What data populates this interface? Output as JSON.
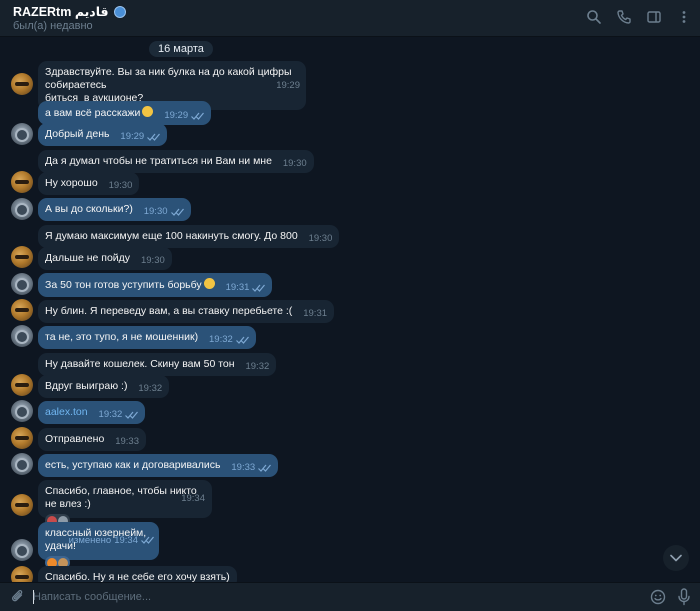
{
  "header": {
    "name": "RAZERtm قاديم",
    "status": "был(а) недавно",
    "icons": [
      "search-icon",
      "phone-icon",
      "sidebar-toggle-icon",
      "more-icon"
    ]
  },
  "chat": {
    "date": "16 марта",
    "messages": [
      {
        "from": "them",
        "text": "Здравствуйте. Вы за ник булка на до какой цифры собираетесь\nбиться  в аукционе?",
        "time": "19:29"
      },
      {
        "from": "me",
        "text": "а вам всё расскажи",
        "emoji": "smirk-emoji",
        "time": "19:29"
      },
      {
        "from": "me",
        "text": "Добрый день",
        "time": "19:29"
      },
      {
        "from": "them",
        "text": "Да я думал чтобы не тратиться ни Вам ни мне",
        "time": "19:30"
      },
      {
        "from": "them",
        "text": "Ну хорошо",
        "time": "19:30"
      },
      {
        "from": "me",
        "text": "А вы до скольки?)",
        "time": "19:30"
      },
      {
        "from": "them",
        "text": "Я думаю максимум еще 100 накинуть смогу. До 800",
        "time": "19:30"
      },
      {
        "from": "them",
        "text": "Дальше не пойду",
        "time": "19:30"
      },
      {
        "from": "me",
        "text": "За 50 тон готов уступить борьбу",
        "emoji": "smile-emoji",
        "time": "19:31"
      },
      {
        "from": "them",
        "text": "Ну блин. Я переведу вам, а вы ставку перебьете :(",
        "time": "19:31"
      },
      {
        "from": "me",
        "text": "та не, это тупо, я не мошенник)",
        "time": "19:32"
      },
      {
        "from": "them",
        "text": "Ну давайте кошелек. Скину вам 50 тон",
        "time": "19:32"
      },
      {
        "from": "them",
        "text": "Вдруг выиграю :)",
        "time": "19:32"
      },
      {
        "from": "me",
        "text": "aalex.ton",
        "time": "19:32"
      },
      {
        "from": "them",
        "text": "Отправлено",
        "time": "19:33"
      },
      {
        "from": "me",
        "text": "есть, уступаю как и договаривались",
        "time": "19:33"
      },
      {
        "from": "them",
        "text": "Спасибо, главное, чтобы никто не влез :)",
        "time": "19:34"
      },
      {
        "from": "me",
        "text": "классный юзернейм, удачи!",
        "edited": "изменено",
        "time": "19:34"
      },
      {
        "from": "them",
        "text": "Спасибо. Ну я не себе его хочу взять)",
        "time": ""
      }
    ]
  },
  "composer": {
    "placeholder": "Написать сообщение..."
  },
  "colors": {
    "background": "#0e1621",
    "panel": "#17212b",
    "incoming": "#182533",
    "outgoing": "#2b5278",
    "link": "#71b6f0"
  }
}
